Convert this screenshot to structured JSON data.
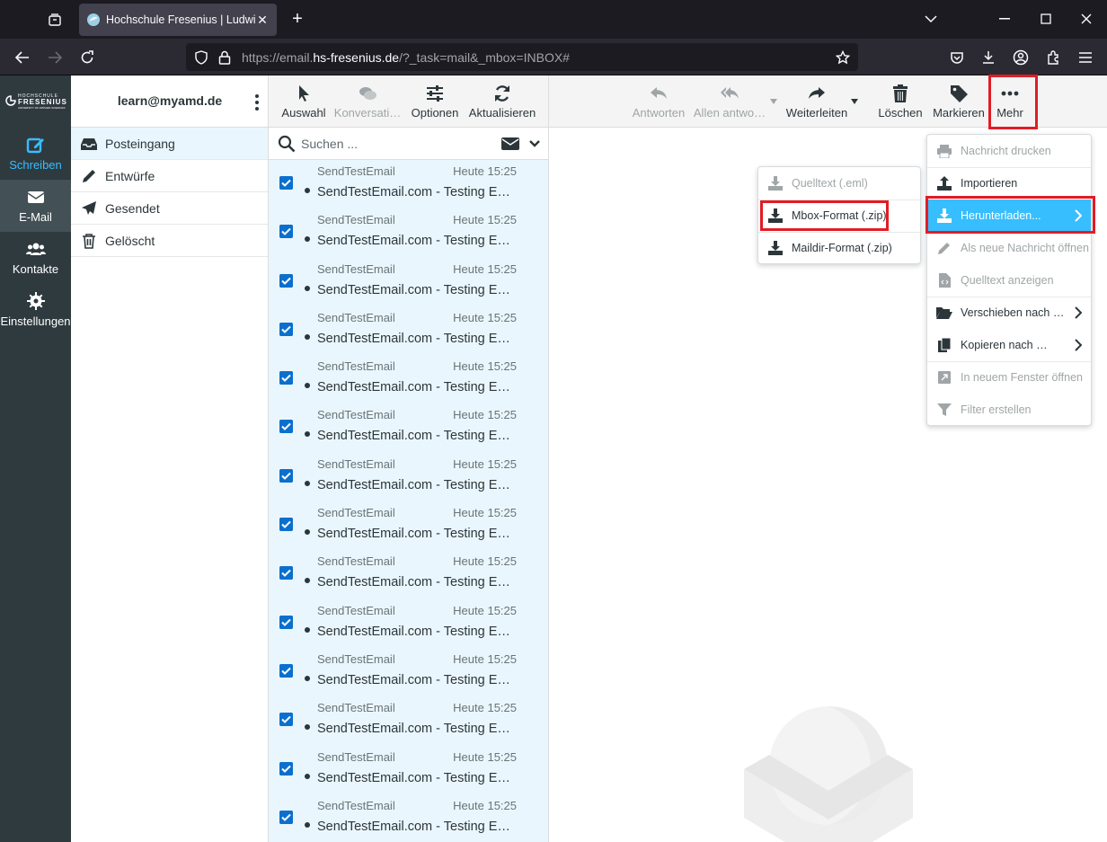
{
  "browser": {
    "tab_title": "Hochschule Fresenius | Ludwig",
    "url_prefix": "https://email.",
    "url_host": "hs-fresenius.de",
    "url_rest": "/?_task=mail&_mbox=INBOX#"
  },
  "logo": {
    "line1": "HOCHSCHULE",
    "line2": "FRESENIUS",
    "line3": "UNIVERSITY OF APPLIED SCIENCES"
  },
  "nav": {
    "compose": "Schreiben",
    "mail": "E-Mail",
    "contacts": "Kontakte",
    "settings": "Einstellungen"
  },
  "account": "learn@myamd.de",
  "folders": [
    "Posteingang",
    "Entwürfe",
    "Gesendet",
    "Gelöscht"
  ],
  "list_toolbar": {
    "select": "Auswahl",
    "threads": "Konversati…",
    "options": "Optionen",
    "refresh": "Aktualisieren"
  },
  "search": {
    "placeholder": "Suchen ..."
  },
  "messages": [
    {
      "from": "SendTestEmail",
      "time": "Heute 15:25",
      "subject": "SendTestEmail.com - Testing Email ID"
    },
    {
      "from": "SendTestEmail",
      "time": "Heute 15:25",
      "subject": "SendTestEmail.com - Testing Email ID"
    },
    {
      "from": "SendTestEmail",
      "time": "Heute 15:25",
      "subject": "SendTestEmail.com - Testing Email ID"
    },
    {
      "from": "SendTestEmail",
      "time": "Heute 15:25",
      "subject": "SendTestEmail.com - Testing Email ID"
    },
    {
      "from": "SendTestEmail",
      "time": "Heute 15:25",
      "subject": "SendTestEmail.com - Testing Email ID"
    },
    {
      "from": "SendTestEmail",
      "time": "Heute 15:25",
      "subject": "SendTestEmail.com - Testing Email ID"
    },
    {
      "from": "SendTestEmail",
      "time": "Heute 15:25",
      "subject": "SendTestEmail.com - Testing Email ID"
    },
    {
      "from": "SendTestEmail",
      "time": "Heute 15:25",
      "subject": "SendTestEmail.com - Testing Email ID"
    },
    {
      "from": "SendTestEmail",
      "time": "Heute 15:25",
      "subject": "SendTestEmail.com - Testing Email ID"
    },
    {
      "from": "SendTestEmail",
      "time": "Heute 15:25",
      "subject": "SendTestEmail.com - Testing Email ID"
    },
    {
      "from": "SendTestEmail",
      "time": "Heute 15:25",
      "subject": "SendTestEmail.com - Testing Email ID"
    },
    {
      "from": "SendTestEmail",
      "time": "Heute 15:25",
      "subject": "SendTestEmail.com - Testing Email ID"
    },
    {
      "from": "SendTestEmail",
      "time": "Heute 15:25",
      "subject": "SendTestEmail.com - Testing Email ID"
    },
    {
      "from": "SendTestEmail",
      "time": "Heute 15:25",
      "subject": "SendTestEmail.com - Testing Email ID"
    }
  ],
  "msg_toolbar": {
    "reply": "Antworten",
    "reply_all": "Allen antwo…",
    "forward": "Weiterleiten",
    "delete": "Löschen",
    "mark": "Markieren",
    "more": "Mehr"
  },
  "more_menu": {
    "print": "Nachricht drucken",
    "import": "Importieren",
    "download": "Herunterladen...",
    "open_new": "Als neue Nachricht öffnen",
    "source": "Quelltext anzeigen",
    "move": "Verschieben nach …",
    "copy": "Kopieren nach …",
    "new_window": "In neuem Fenster öffnen",
    "filter": "Filter erstellen"
  },
  "download_menu": {
    "eml": "Quelltext (.eml)",
    "mbox": "Mbox-Format (.zip)",
    "maildir": "Maildir-Format (.zip)"
  },
  "colors": {
    "accent": "#37beff",
    "highlight": "#e21c24",
    "nav_bg": "#2f3a3f",
    "checkbox": "#0b6fce"
  }
}
